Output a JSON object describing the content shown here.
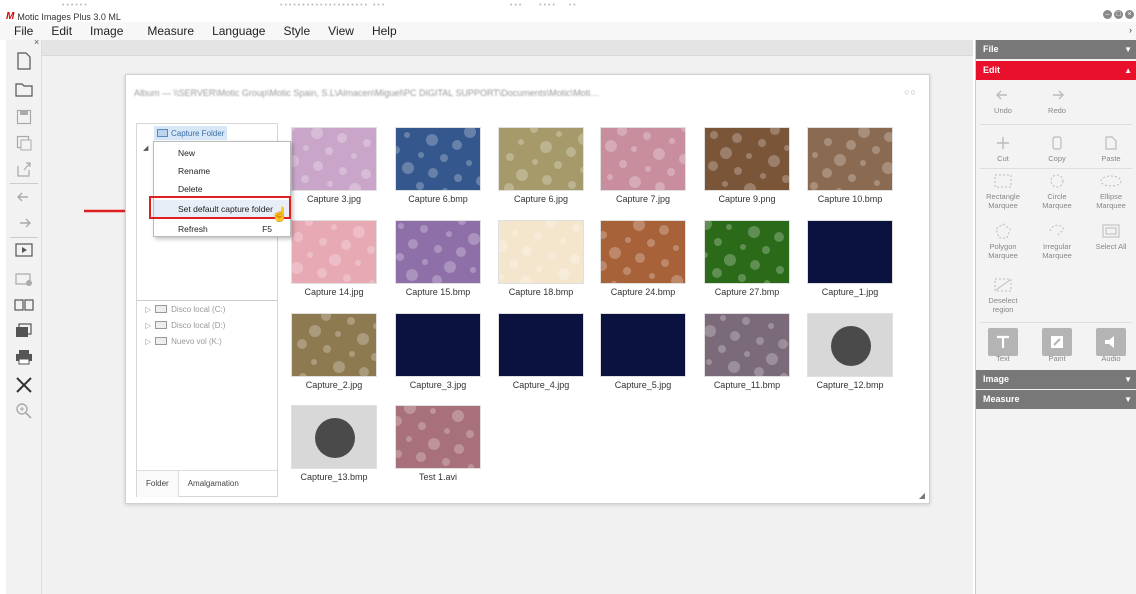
{
  "window": {
    "title": "Motic Images Plus 3.0 ML",
    "logo": "M"
  },
  "menu": [
    "File",
    "Edit",
    "Image",
    "Measure",
    "Language",
    "Style",
    "View",
    "Help"
  ],
  "album": {
    "title": "Album — \\\\SERVER\\Motic Group\\Motic Spain, S.L\\Almacen\\Miguel\\PC DIGITAL SUPPORT\\Documents\\Motic\\Moti…"
  },
  "folder_tree": {
    "root": "Capture Folder",
    "drives": [
      "Disco local (C:)",
      "Disco local (D:)",
      "Nuevo vol (K:)"
    ],
    "tabs": [
      "Folder",
      "Amalgamation"
    ]
  },
  "context_menu": {
    "items": [
      {
        "label": "New",
        "shortcut": ""
      },
      {
        "label": "Rename",
        "shortcut": ""
      },
      {
        "label": "Delete",
        "shortcut": ""
      },
      {
        "label": "Set default capture folder",
        "shortcut": ""
      },
      {
        "label": "Refresh",
        "shortcut": "F5"
      }
    ]
  },
  "thumbnails": [
    {
      "label": "Capture 3.jpg",
      "color": "#c9a6c9"
    },
    {
      "label": "Capture 6.bmp",
      "color": "#34578d"
    },
    {
      "label": "Capture 6.jpg",
      "color": "#a69a6a"
    },
    {
      "label": "Capture 7.jpg",
      "color": "#c88e9e"
    },
    {
      "label": "Capture 9.png",
      "color": "#7a5538"
    },
    {
      "label": "Capture 10.bmp",
      "color": "#8a6a50"
    },
    {
      "label": "Capture 14.jpg",
      "color": "#e7a9b4"
    },
    {
      "label": "Capture 15.bmp",
      "color": "#8e6fa8"
    },
    {
      "label": "Capture 18.bmp",
      "color": "#f4e6cc"
    },
    {
      "label": "Capture 24.bmp",
      "color": "#a8623a"
    },
    {
      "label": "Capture 27.bmp",
      "color": "#2a6a18"
    },
    {
      "label": "Capture_1.jpg",
      "color": "#0c1240"
    },
    {
      "label": "Capture_2.jpg",
      "color": "#8e7a50"
    },
    {
      "label": "Capture_3.jpg",
      "color": "#0c1240"
    },
    {
      "label": "Capture_4.jpg",
      "color": "#0c1240"
    },
    {
      "label": "Capture_5.jpg",
      "color": "#0c1240"
    },
    {
      "label": "Capture_11.bmp",
      "color": "#7a6a7a"
    },
    {
      "label": "Capture_12.bmp",
      "color": "#d8d8d8"
    },
    {
      "label": "Capture_13.bmp",
      "color": "#d8d8d8"
    },
    {
      "label": "Test 1.avi",
      "color": "#a8707a"
    }
  ],
  "right_panel": {
    "sections": {
      "file": "File",
      "edit": "Edit",
      "image": "Image",
      "measure": "Measure"
    },
    "tools": [
      "Undo",
      "Redo",
      "Cut",
      "Copy",
      "Paste",
      "Rectangle Marquee",
      "Circle Marquee",
      "Ellipse Marquee",
      "Polygon Marquee",
      "Irregular Marquee",
      "Select All",
      "Deselect region"
    ],
    "big_tools": [
      "Text",
      "Paint",
      "Audio"
    ]
  },
  "colors": {
    "accent": "#e8102a",
    "highlight_box": "#e02020",
    "section_header": "#787878"
  }
}
